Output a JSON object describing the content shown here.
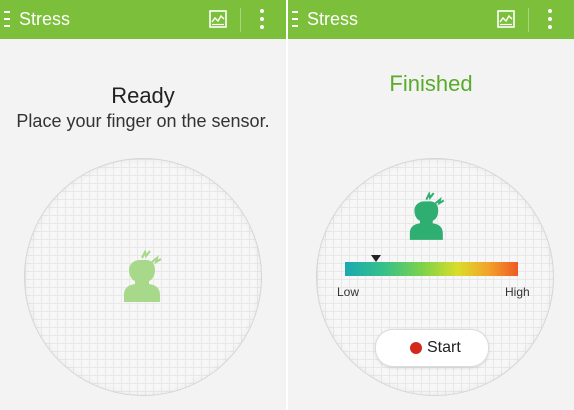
{
  "screens": [
    {
      "appbar": {
        "title": "Stress"
      },
      "status": "Ready",
      "instruction": "Place your finger on the sensor."
    },
    {
      "appbar": {
        "title": "Stress"
      },
      "status": "Finished",
      "scale": {
        "low_label": "Low",
        "high_label": "High",
        "level": 0.18
      },
      "start_label": "Start"
    }
  ],
  "icons": {
    "nav": "menu-icon",
    "history": "history-chart-icon",
    "more": "more-vertical-icon",
    "person": "stressed-person-icon",
    "record": "record-dot-icon"
  },
  "colors": {
    "appbar": "#7cbf3a",
    "finished_text": "#5aab2b",
    "person_idle": "#a8d98a",
    "person_done": "#2fae72",
    "record_dot": "#d12a1a"
  }
}
